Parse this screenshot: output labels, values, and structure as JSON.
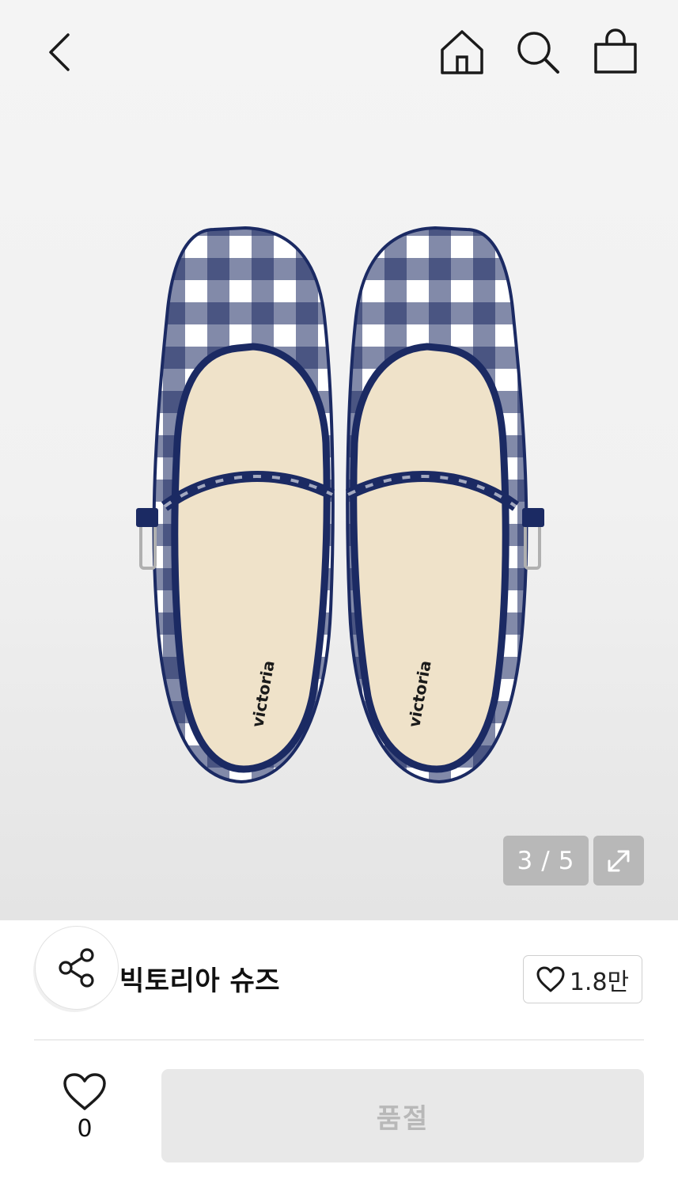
{
  "header": {
    "back_icon": "chevron-left-icon",
    "home_icon": "home-icon",
    "search_icon": "search-icon",
    "cart_icon": "shopping-bag-icon"
  },
  "gallery": {
    "current": "3",
    "separator": "/",
    "total": "5",
    "expand_icon": "expand-arrows-icon",
    "logo_text_left": "victoria",
    "logo_text_right": "victoria"
  },
  "product": {
    "brand_name": "빅토리아 슈즈",
    "like_count": "1.8만",
    "share_icon": "share-icon"
  },
  "bottom_bar": {
    "wish_count": "0",
    "soldout_label": "품절"
  },
  "colors": {
    "gingham_navy": "#1b2a63",
    "insole": "#efe2c9",
    "badge_bg": "#b8b8b8",
    "disabled_button": "#e8e8e8"
  }
}
